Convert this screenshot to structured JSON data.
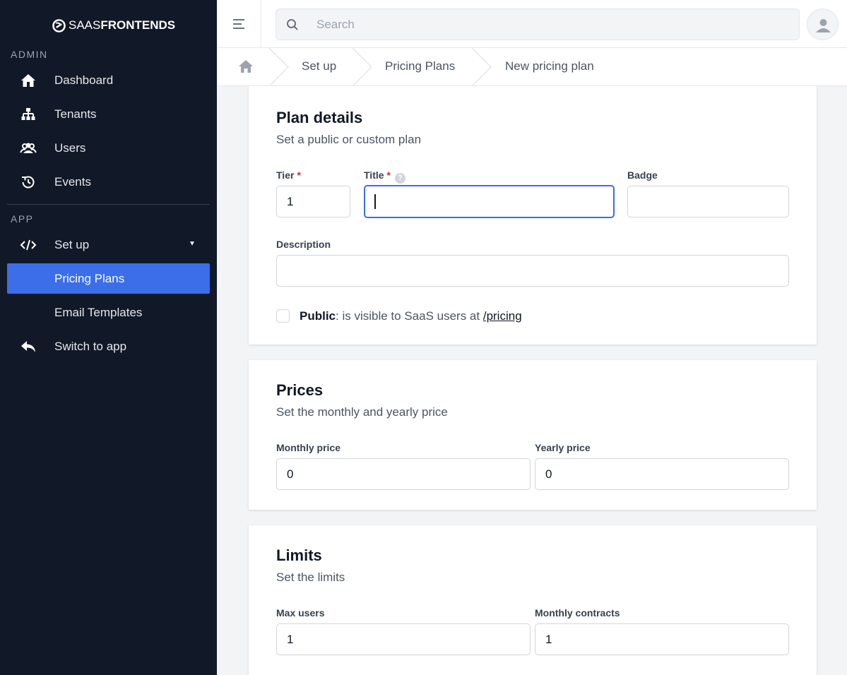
{
  "brand": {
    "light": "SAAS",
    "bold": "FRONTENDS"
  },
  "sidebar": {
    "admin_label": "ADMIN",
    "app_label": "APP",
    "admin_items": [
      {
        "label": "Dashboard",
        "icon": "home-icon"
      },
      {
        "label": "Tenants",
        "icon": "sitemap-icon"
      },
      {
        "label": "Users",
        "icon": "users-icon"
      },
      {
        "label": "Events",
        "icon": "history-icon"
      }
    ],
    "app_items": [
      {
        "label": "Set up",
        "icon": "code-icon",
        "expanded": true
      },
      {
        "label": "Pricing Plans",
        "active": true
      },
      {
        "label": "Email Templates"
      },
      {
        "label": "Switch to app",
        "icon": "reply-icon"
      }
    ]
  },
  "search": {
    "placeholder": "Search"
  },
  "breadcrumb": [
    "Set up",
    "Pricing Plans",
    "New pricing plan"
  ],
  "plan_details": {
    "title": "Plan details",
    "subtitle": "Set a public or custom plan",
    "tier_label": "Tier",
    "tier_value": "1",
    "title_label": "Title",
    "title_value": "",
    "badge_label": "Badge",
    "badge_value": "",
    "description_label": "Description",
    "description_value": "",
    "public_label": "Public",
    "public_text": ": is visible to SaaS users at ",
    "public_link": "/pricing",
    "public_checked": false
  },
  "prices": {
    "title": "Prices",
    "subtitle": "Set the monthly and yearly price",
    "monthly_label": "Monthly price",
    "monthly_value": "0",
    "yearly_label": "Yearly price",
    "yearly_value": "0"
  },
  "limits": {
    "title": "Limits",
    "subtitle": "Set the limits",
    "max_users_label": "Max users",
    "max_users_value": "1",
    "monthly_contracts_label": "Monthly contracts",
    "monthly_contracts_value": "1"
  },
  "colors": {
    "sidebar_bg": "#111827",
    "accent": "#3b6ee8",
    "required": "#dc2626"
  }
}
